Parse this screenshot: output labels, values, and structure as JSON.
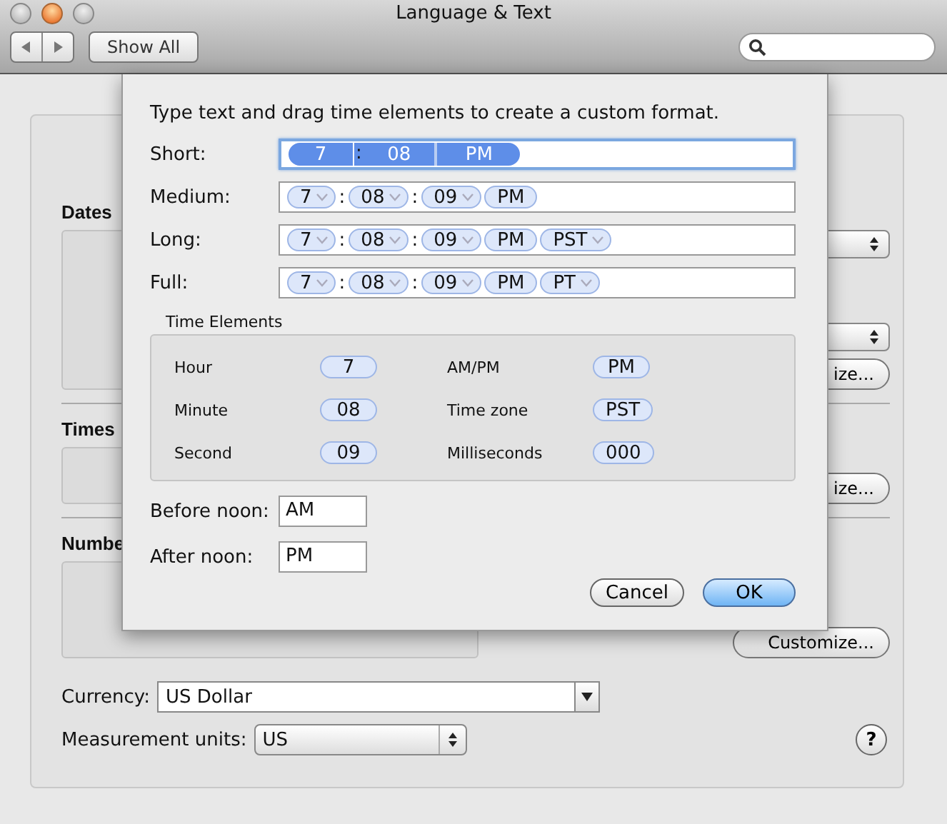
{
  "window": {
    "title": "Language & Text"
  },
  "toolbar": {
    "show_all": "Show All"
  },
  "sections": [
    {
      "title": "Dates",
      "customize": "ize..."
    },
    {
      "title": "Times",
      "customize": "ize..."
    },
    {
      "title": "Numbe",
      "customize": "Customize..."
    }
  ],
  "currency": {
    "label": "Currency:",
    "value": "US Dollar"
  },
  "measurement": {
    "label": "Measurement units:",
    "value": "US"
  },
  "help": "?",
  "sheet": {
    "instruction": "Type text and drag time elements to create a custom format.",
    "formats": [
      {
        "label": "Short:",
        "focused": true,
        "tokens": [
          {
            "kind": "token",
            "text": "7",
            "selected": true,
            "menu": false
          },
          {
            "kind": "separator",
            "text": ":",
            "selected": true
          },
          {
            "kind": "token",
            "text": "08",
            "selected": true,
            "menu": false
          },
          {
            "kind": "divider",
            "selected": true
          },
          {
            "kind": "token",
            "text": "PM",
            "selected": true,
            "menu": false
          }
        ]
      },
      {
        "label": "Medium:",
        "focused": false,
        "tokens": [
          {
            "kind": "token",
            "text": "7",
            "selected": false,
            "menu": true
          },
          {
            "kind": "separator",
            "text": ":",
            "selected": false
          },
          {
            "kind": "token",
            "text": "08",
            "selected": false,
            "menu": true
          },
          {
            "kind": "separator",
            "text": ":",
            "selected": false
          },
          {
            "kind": "token",
            "text": "09",
            "selected": false,
            "menu": true
          },
          {
            "kind": "token",
            "text": "PM",
            "selected": false,
            "menu": false
          }
        ]
      },
      {
        "label": "Long:",
        "focused": false,
        "tokens": [
          {
            "kind": "token",
            "text": "7",
            "selected": false,
            "menu": true
          },
          {
            "kind": "separator",
            "text": ":",
            "selected": false
          },
          {
            "kind": "token",
            "text": "08",
            "selected": false,
            "menu": true
          },
          {
            "kind": "separator",
            "text": ":",
            "selected": false
          },
          {
            "kind": "token",
            "text": "09",
            "selected": false,
            "menu": true
          },
          {
            "kind": "token",
            "text": "PM",
            "selected": false,
            "menu": false
          },
          {
            "kind": "token",
            "text": "PST",
            "selected": false,
            "menu": true
          }
        ]
      },
      {
        "label": "Full:",
        "focused": false,
        "tokens": [
          {
            "kind": "token",
            "text": "7",
            "selected": false,
            "menu": true
          },
          {
            "kind": "separator",
            "text": ":",
            "selected": false
          },
          {
            "kind": "token",
            "text": "08",
            "selected": false,
            "menu": true
          },
          {
            "kind": "separator",
            "text": ":",
            "selected": false
          },
          {
            "kind": "token",
            "text": "09",
            "selected": false,
            "menu": true
          },
          {
            "kind": "token",
            "text": "PM",
            "selected": false,
            "menu": false
          },
          {
            "kind": "token",
            "text": "PT",
            "selected": false,
            "menu": true
          }
        ]
      }
    ],
    "time_elements": {
      "title": "Time Elements",
      "items": [
        {
          "label": "Hour",
          "token": "7"
        },
        {
          "label": "AM/PM",
          "token": "PM"
        },
        {
          "label": "Minute",
          "token": "08"
        },
        {
          "label": "Time zone",
          "token": "PST"
        },
        {
          "label": "Second",
          "token": "09"
        },
        {
          "label": "Milliseconds",
          "token": "000"
        }
      ]
    },
    "before_noon": {
      "label": "Before noon:",
      "value": "AM"
    },
    "after_noon": {
      "label": "After noon:",
      "value": "PM"
    },
    "buttons": [
      {
        "label": "Cancel",
        "default": false
      },
      {
        "label": "OK",
        "default": true
      }
    ]
  }
}
